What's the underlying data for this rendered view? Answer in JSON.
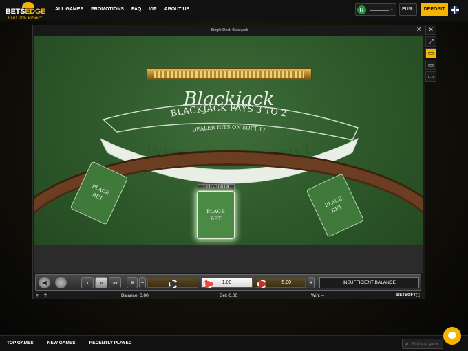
{
  "brand": {
    "name_a": "BETS",
    "name_b": "EDGE",
    "tagline": "PLAY THE EDGE™"
  },
  "nav": [
    "ALL GAMES",
    "PROMOTIONS",
    "FAQ",
    "VIP",
    "ABOUT US"
  ],
  "account": {
    "badge": "R",
    "currency": "EUR",
    "deposit_label": "DEPOSIT"
  },
  "game": {
    "title": "Single Deck Blackjack",
    "table_title": "Blackjack",
    "pays_text": "BLACKJACK PAYS 3 TO 2",
    "dealer_text": "DEALER HITS ON SOFT 17",
    "insurance_text": "INSURANCE PAYS 2 TO 1",
    "place_bet_line1": "PLACE",
    "place_bet_line2": "BET",
    "limits": "1.00 - 100.00",
    "controls": {
      "bet_value": "1.00",
      "max_value": "5.00",
      "minus": "−",
      "plus": "+",
      "status": "INSUFFICIENT BALANCE"
    },
    "statusbar": {
      "balance": "Balance: 0.00",
      "bet": "Bet: 0.00",
      "win": "Win: --",
      "provider": "BETSOFT",
      "help": "?"
    }
  },
  "bottomnav": [
    "TOP GAMES",
    "NEW GAMES",
    "RECENTLY PLAYED"
  ],
  "search": {
    "placeholder": "Find your game"
  },
  "colors": {
    "accent": "#f5b400",
    "felt": "#2f5a2c",
    "rail": "#6b3d21"
  }
}
